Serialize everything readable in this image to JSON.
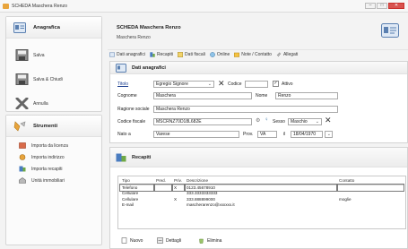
{
  "window": {
    "title": "SCHEDA Maschera Renzo",
    "minimize": "–",
    "maximize": "□",
    "close": "✕"
  },
  "sidebar": {
    "panel1": {
      "title": "Anagrafica",
      "items": [
        {
          "label": "Salva",
          "icon": "save-icon"
        },
        {
          "label": "Salva & Chiudi",
          "icon": "save-close-icon"
        },
        {
          "label": "Annulla",
          "icon": "cancel-x-icon"
        }
      ]
    },
    "panel2": {
      "title": "Strumenti",
      "items": [
        {
          "label": "Importa da licenza",
          "icon": "import-license-icon"
        },
        {
          "label": "Importa indirizzo",
          "icon": "import-address-icon"
        },
        {
          "label": "Importa recapiti",
          "icon": "import-contacts-icon"
        },
        {
          "label": "Unità immobiliari",
          "icon": "building-icon"
        }
      ]
    }
  },
  "header": {
    "title": "SCHEDA Maschera Renzo",
    "subtitle": "Maschera Renzo"
  },
  "tabs": [
    {
      "label": "Dati anagrafici"
    },
    {
      "label": "Recapiti"
    },
    {
      "label": "Dati fiscali"
    },
    {
      "label": "Online"
    },
    {
      "label": "Note / Contatto"
    },
    {
      "label": "Allegati"
    }
  ],
  "anagrafica": {
    "section_title": "Dati anagrafici",
    "titolo_label": "Titolo",
    "titolo_value": "Egregio Signore",
    "codice_label": "Codice",
    "codice_value": "",
    "attivo_label": "Attivo",
    "cognome_label": "Cognome",
    "cognome_value": "Maschera",
    "nome_label": "Nome",
    "nome_value": "Renzo",
    "ragione_label": "Ragione sociale",
    "ragione_value": "Maschera Renzo",
    "cf_label": "Codice fiscale",
    "cf_value": "MSCRNZ70D18L682E",
    "sesso_label": "Sesso",
    "sesso_value": "Maschio",
    "nato_label": "Nato a",
    "nato_value": "Varese",
    "prov_label": "Prov.",
    "prov_value": "VA",
    "il_label": "il",
    "il_value": "18/04/1970"
  },
  "recapiti": {
    "section_title": "Recapiti",
    "columns": [
      "Tipo",
      "Pred.",
      "Priv.",
      "Descrizione",
      "Contatto"
    ],
    "rows": [
      {
        "tipo": "Telefono",
        "pred": "",
        "priv": "X",
        "descrizione": "0123.45678910",
        "contatto": ""
      },
      {
        "tipo": "Cellulare",
        "pred": "",
        "priv": "",
        "descrizione": "333.3333333333",
        "contatto": ""
      },
      {
        "tipo": "Cellulare",
        "pred": "",
        "priv": "X",
        "descrizione": "333.888899000",
        "contatto": "moglie"
      },
      {
        "tipo": "E-mail",
        "pred": "",
        "priv": "",
        "descrizione": "mascherarenzo@xxxxxx.it",
        "contatto": ""
      }
    ],
    "buttons": {
      "nuovo": "Nuovo",
      "dettagli": "Dettagli",
      "elimina": "Elimina"
    }
  },
  "colors": {
    "accent": "#e8a43c",
    "border": "#d4d4d4",
    "link": "#1a3d8f"
  }
}
